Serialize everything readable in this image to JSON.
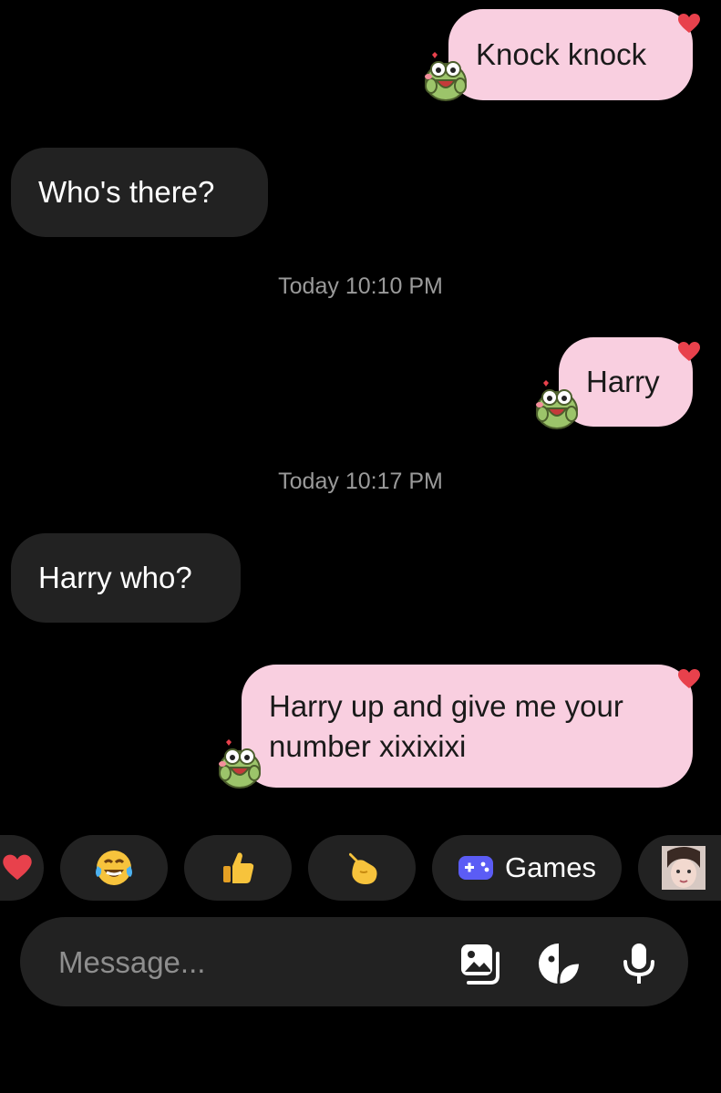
{
  "messages": [
    {
      "direction": "outgoing",
      "text": "Knock knock",
      "reaction": "heart",
      "sticker": "frog-sticker"
    },
    {
      "direction": "incoming",
      "text": "Who's there?"
    },
    {
      "direction": "outgoing",
      "text": "Harry",
      "reaction": "heart",
      "sticker": "frog-sticker"
    },
    {
      "direction": "incoming",
      "text": "Harry who?"
    },
    {
      "direction": "outgoing",
      "text_lines": [
        "Harry up and give me your",
        "number xixixixi"
      ],
      "reaction": "heart",
      "sticker": "frog-sticker"
    }
  ],
  "timestamps": [
    "Today 10:10 PM",
    "Today 10:17 PM"
  ],
  "quick_replies": [
    {
      "icon": "heart-emoji"
    },
    {
      "icon": "tears-of-joy-emoji"
    },
    {
      "icon": "thumbs-up-emoji"
    },
    {
      "icon": "pointing-hand-emoji"
    },
    {
      "icon": "gamepad-icon",
      "label": "Games"
    },
    {
      "icon": "avatar-thumbnail"
    }
  ],
  "composer": {
    "placeholder": "Message...",
    "icons": [
      "gallery-icon",
      "sticker-icon",
      "microphone-icon"
    ]
  },
  "colors": {
    "background": "#000000",
    "outgoing_bubble": "#f9cfe0",
    "incoming_bubble": "#222222",
    "timestamp": "#9a9a9a",
    "reaction_heart": "#e8414c"
  }
}
